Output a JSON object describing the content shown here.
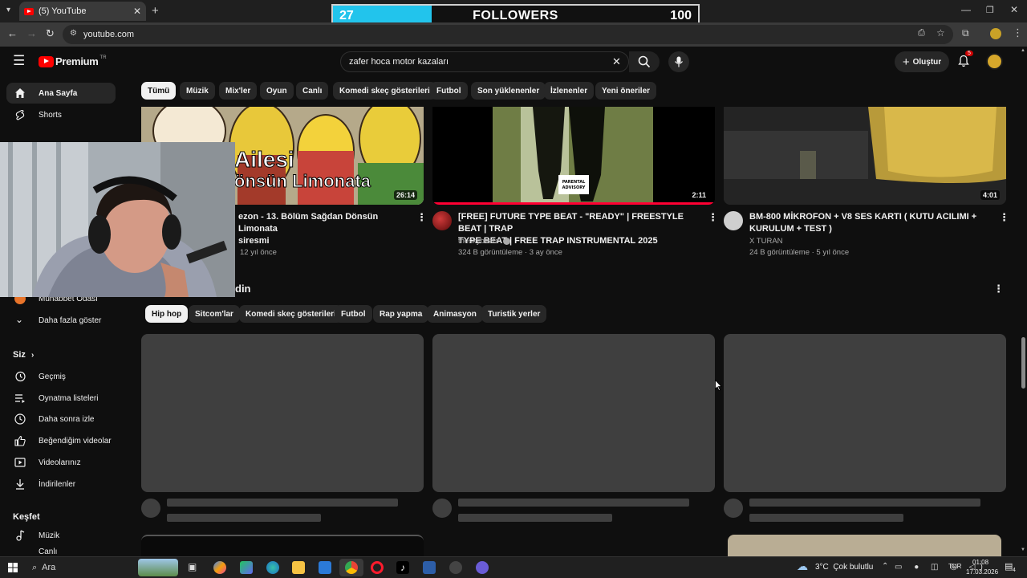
{
  "browser": {
    "tab_title": "(5) YouTube",
    "url": "youtube.com"
  },
  "overlay": {
    "current": "27",
    "label": "FOLLOWERS",
    "goal": "100",
    "progress": 0.27
  },
  "header": {
    "logo": "Premium",
    "region": "TR",
    "search_value": "zafer hoca motor kazaları",
    "create_label": "Oluştur",
    "notifications": "5"
  },
  "chips": [
    "Tümü",
    "Müzik",
    "Mix'ler",
    "Oyun",
    "Canlı",
    "Komedi skeç gösterileri",
    "Futbol",
    "Son yüklenenler",
    "İzlenenler",
    "Yeni öneriler"
  ],
  "sidebar": {
    "top": [
      {
        "label": "Ana Sayfa",
        "icon": "home-icon"
      },
      {
        "label": "Shorts",
        "icon": "shorts-icon"
      }
    ],
    "sub_partial": "Muhabbet Odası",
    "more": "Daha fazla göster",
    "you_header": "Siz",
    "you_items": [
      {
        "label": "Geçmiş",
        "icon": "history-icon"
      },
      {
        "label": "Oynatma listeleri",
        "icon": "playlist-icon"
      },
      {
        "label": "Daha sonra izle",
        "icon": "clock-icon"
      },
      {
        "label": "Beğendiğim videolar",
        "icon": "thumbs-up-icon"
      },
      {
        "label": "Videolarınız",
        "icon": "video-icon"
      },
      {
        "label": "İndirilenler",
        "icon": "download-icon"
      }
    ],
    "explore_header": "Keşfet",
    "explore_items": [
      {
        "label": "Müzik",
        "icon": "music-icon"
      },
      {
        "label": "Canlı",
        "icon": "live-icon"
      }
    ]
  },
  "videos": [
    {
      "thumb_text_1": "Ailesi",
      "thumb_text_2": "önsün Limonata",
      "duration": "26:14",
      "title_line1": "ezon - 13. Bölüm Sağdan Dönsün Limonata",
      "title_line2": "siresmi",
      "meta": "12 yıl önce"
    },
    {
      "duration": "2:11",
      "title_line1": "[FREE] FUTURE TYPE BEAT - \"READY\" | FREESTYLE BEAT | TRAP",
      "title_line2": "TYPE BEAT | FREE TRAP INSTRUMENTAL 2025",
      "channel": "theskybeats",
      "meta": "324 B görüntüleme · 3 ay önce"
    },
    {
      "duration": "4:01",
      "title_line1": "BM-800 MİKROFON + V8 SES KARTI ( KUTU ACILIMI +",
      "title_line2": "KURULUM + TEST )",
      "channel": "X TURAN",
      "meta": "24 B görüntüleme · 5 yıl önce"
    }
  ],
  "section": {
    "title_partial": "din",
    "chips": [
      "Hip hop",
      "Sitcom'lar",
      "Komedi skeç gösterileri",
      "Futbol",
      "Rap yapma",
      "Animasyon",
      "Turistik yerler"
    ]
  },
  "taskbar": {
    "search_label": "Ara",
    "weather": "3°C  Çok bulutlu",
    "lang": "TUR",
    "time": "01:08",
    "date": "17.03.2026",
    "notif_count": "4"
  },
  "colors": {
    "yt_red": "#ff0000",
    "bg": "#0f0f0f",
    "chip_bg": "#272727",
    "overlay_fill": "#22c4ec"
  }
}
